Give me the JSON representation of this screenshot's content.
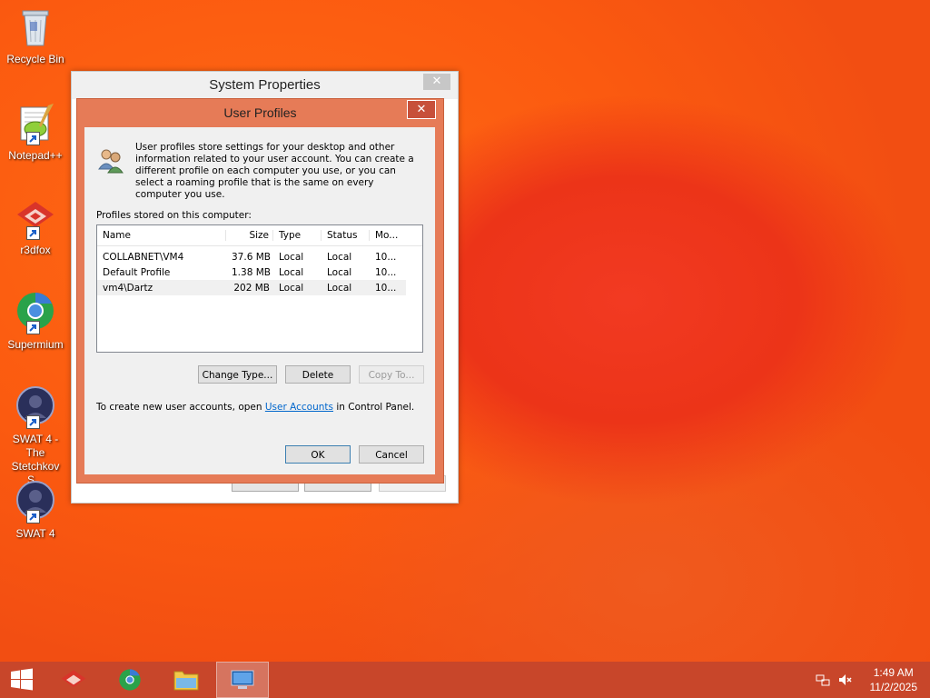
{
  "desktop": {
    "icons": [
      {
        "label": "Recycle Bin"
      },
      {
        "label": "Notepad++"
      },
      {
        "label": "r3dfox"
      },
      {
        "label": "Supermium"
      },
      {
        "label": "SWAT 4 - The Stetchkov S..."
      },
      {
        "label": "SWAT 4"
      }
    ]
  },
  "system_properties": {
    "title": "System Properties",
    "close_label": "✕"
  },
  "user_profiles": {
    "title": "User Profiles",
    "close_label": "✕",
    "intro": "User profiles store settings for your desktop and other information related to your user account. You can create a different profile on each computer you use, or you can select a roaming profile that is the same on every computer you use.",
    "profiles_label": "Profiles stored on this computer:",
    "columns": {
      "name": "Name",
      "size": "Size",
      "type": "Type",
      "status": "Status",
      "modified": "Mo..."
    },
    "rows": [
      {
        "name": "COLLABNET\\VM4",
        "size": "37.6 MB",
        "type": "Local",
        "status": "Local",
        "modified": "10..."
      },
      {
        "name": "Default Profile",
        "size": "1.38 MB",
        "type": "Local",
        "status": "Local",
        "modified": "10..."
      },
      {
        "name": "vm4\\Dartz",
        "size": "202 MB",
        "type": "Local",
        "status": "Local",
        "modified": "10..."
      }
    ],
    "buttons": {
      "change_type": "Change Type...",
      "delete": "Delete",
      "copy_to": "Copy To...",
      "ok": "OK",
      "cancel": "Cancel"
    },
    "footer": {
      "prefix": "To create new user accounts, open ",
      "link": "User Accounts",
      "suffix": " in Control Panel."
    }
  },
  "taskbar": {
    "clock": {
      "time": "1:49 AM",
      "date": "11/2/2025"
    }
  }
}
